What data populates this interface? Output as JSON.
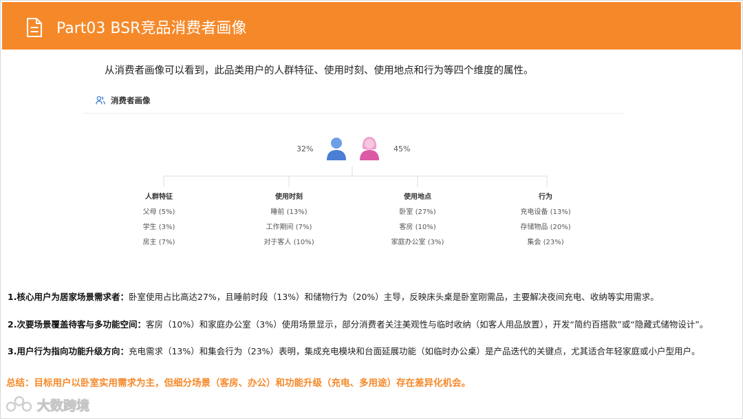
{
  "header": {
    "title": "Part03 BSR竞品消费者画像",
    "icon": "document-icon"
  },
  "intro": "从消费者画像可以看到，此品类用户的人群特征、使用时刻、使用地点和行为等四个维度的属性。",
  "card": {
    "title": "消费者画像",
    "male_pct": "32%",
    "female_pct": "45%",
    "columns": [
      {
        "title": "人群特征",
        "items": [
          "父母 (5%)",
          "学生 (3%)",
          "房主 (7%)"
        ]
      },
      {
        "title": "使用时刻",
        "items": [
          "睡前 (13%)",
          "工作期间 (7%)",
          "对于客人 (10%)"
        ]
      },
      {
        "title": "使用地点",
        "items": [
          "卧室 (27%)",
          "客房 (10%)",
          "家庭办公室 (3%)"
        ]
      },
      {
        "title": "行为",
        "items": [
          "充电设备 (13%)",
          "存储物品 (20%)",
          "集会 (23%)"
        ]
      }
    ]
  },
  "points": [
    {
      "label": "1.核心用户为居家场景需求者：",
      "text": "卧室使用占比高达27%，且睡前时段（13%）和储物行为（20%）主导，反映床头桌是卧室刚需品，主要解决夜间充电、收纳等实用需求。"
    },
    {
      "label": "2.次要场景覆盖待客与多功能空间：",
      "text": "客房（10%）和家庭办公室（3%）使用场景显示，部分消费者关注美观性与临时收纳（如客人用品放置），开发“简约百搭款”或“隐藏式储物设计”。"
    },
    {
      "label": "3.用户行为指向功能升级方向：",
      "text": "充电需求（13%）和集会行为（23%）表明，集成充电模块和台面延展功能（如临时办公桌）是产品迭代的关键点，尤其适合年轻家庭或小户型用户。"
    }
  ],
  "summary": "总结：目标用户以卧室实用需求为主，但细分场景（客房、办公）和功能升级（充电、多用途）存在差异化机会。",
  "watermark": "大数跨境",
  "colors": {
    "accent": "#f5892a",
    "male": "#5b8dd9",
    "female": "#e05aa8"
  }
}
